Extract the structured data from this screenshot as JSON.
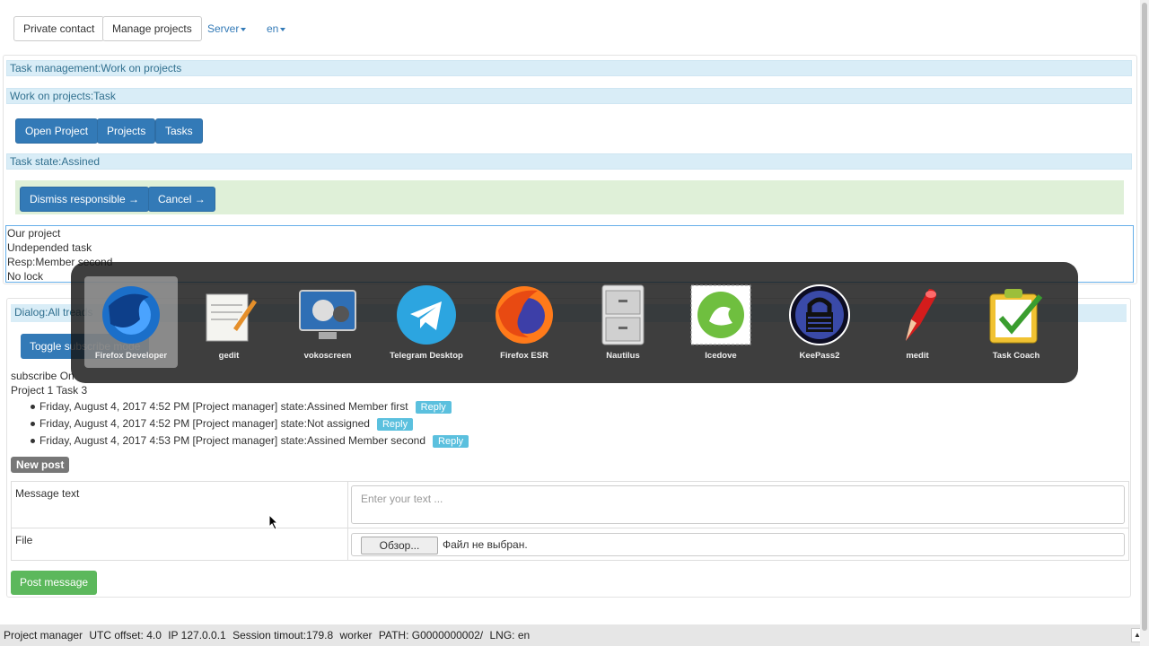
{
  "topbar": {
    "private_contact": "Private contact",
    "manage_projects": "Manage projects",
    "server": "Server",
    "lang": "en"
  },
  "breadcrumbs": {
    "task_management": "Task management:Work on projects",
    "work_on_projects": "Work on projects:Task"
  },
  "nav_buttons": {
    "open_project": "Open Project",
    "projects": "Projects",
    "tasks": "Tasks"
  },
  "task_state": "Task state:Assined",
  "actions": {
    "dismiss": "Dismiss responsible →",
    "cancel": "Cancel →"
  },
  "task_info": {
    "line1": "Our project",
    "line2": "Undepended task",
    "line3": "Resp:Member second",
    "line4": "No lock"
  },
  "dialog": {
    "title": "Dialog:All treads",
    "toggle": "Toggle subscribe mode",
    "subscribe": "subscribe On",
    "thread": "Project 1 Task 3",
    "messages": [
      {
        "text": "Friday, August 4, 2017 4:52 PM [Project manager] state:Assined Member first",
        "reply": "Reply"
      },
      {
        "text": "Friday, August 4, 2017 4:52 PM [Project manager] state:Not assigned",
        "reply": "Reply"
      },
      {
        "text": "Friday, August 4, 2017 4:53 PM [Project manager] state:Assined Member second",
        "reply": "Reply"
      }
    ]
  },
  "new_post": {
    "badge": "New post",
    "message_label": "Message text",
    "message_placeholder": "Enter your text ...",
    "file_label": "File",
    "browse": "Обзор...",
    "no_file": "Файл не выбран.",
    "submit": "Post message"
  },
  "status": {
    "role": "Project manager",
    "utc": "UTC offset: 4.0",
    "ip": "IP 127.0.0.1",
    "session": "Session timout:179.8",
    "worker": "worker",
    "path": "PATH: G0000000002/",
    "lng": "LNG: en"
  },
  "dock": {
    "apps": [
      {
        "name": "Firefox Developer",
        "icon": "firefox-developer-icon"
      },
      {
        "name": "gedit",
        "icon": "gedit-icon"
      },
      {
        "name": "vokoscreen",
        "icon": "vokoscreen-icon"
      },
      {
        "name": "Telegram Desktop",
        "icon": "telegram-icon"
      },
      {
        "name": "Firefox ESR",
        "icon": "firefox-esr-icon"
      },
      {
        "name": "Nautilus",
        "icon": "nautilus-icon"
      },
      {
        "name": "Icedove",
        "icon": "icedove-icon"
      },
      {
        "name": "KeePass2",
        "icon": "keepass-icon"
      },
      {
        "name": "medit",
        "icon": "medit-icon"
      },
      {
        "name": "Task Coach",
        "icon": "taskcoach-icon"
      }
    ]
  },
  "colors": {
    "primary": "#337ab7",
    "info_bg": "#d9edf7",
    "success_bg": "#dff0d8",
    "reply": "#5bc0de",
    "post": "#5cb85c"
  }
}
